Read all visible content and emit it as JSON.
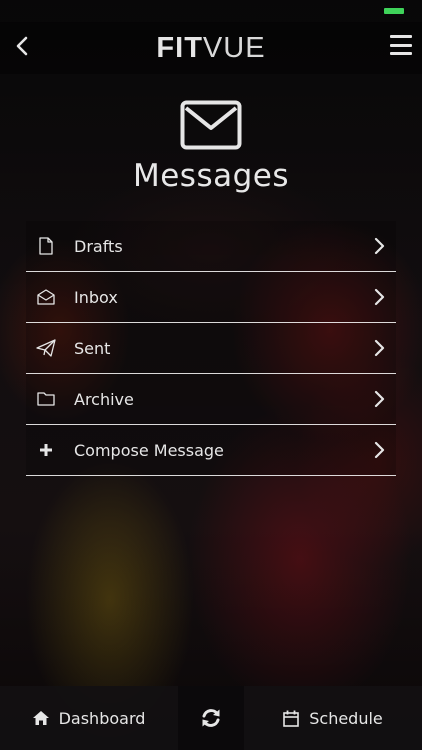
{
  "header": {
    "logo_bold": "FIT",
    "logo_light": "VUE"
  },
  "page": {
    "title": "Messages"
  },
  "menu": {
    "items": [
      {
        "label": "Drafts",
        "icon": "file-icon"
      },
      {
        "label": "Inbox",
        "icon": "inbox-icon"
      },
      {
        "label": "Sent",
        "icon": "paper-plane-icon"
      },
      {
        "label": "Archive",
        "icon": "folder-icon"
      },
      {
        "label": "Compose Message",
        "icon": "plus-icon"
      }
    ]
  },
  "bottom_bar": {
    "dashboard_label": "Dashboard",
    "schedule_label": "Schedule"
  },
  "colors": {
    "battery": "#3fd35a",
    "text": "#e6e6e6"
  }
}
